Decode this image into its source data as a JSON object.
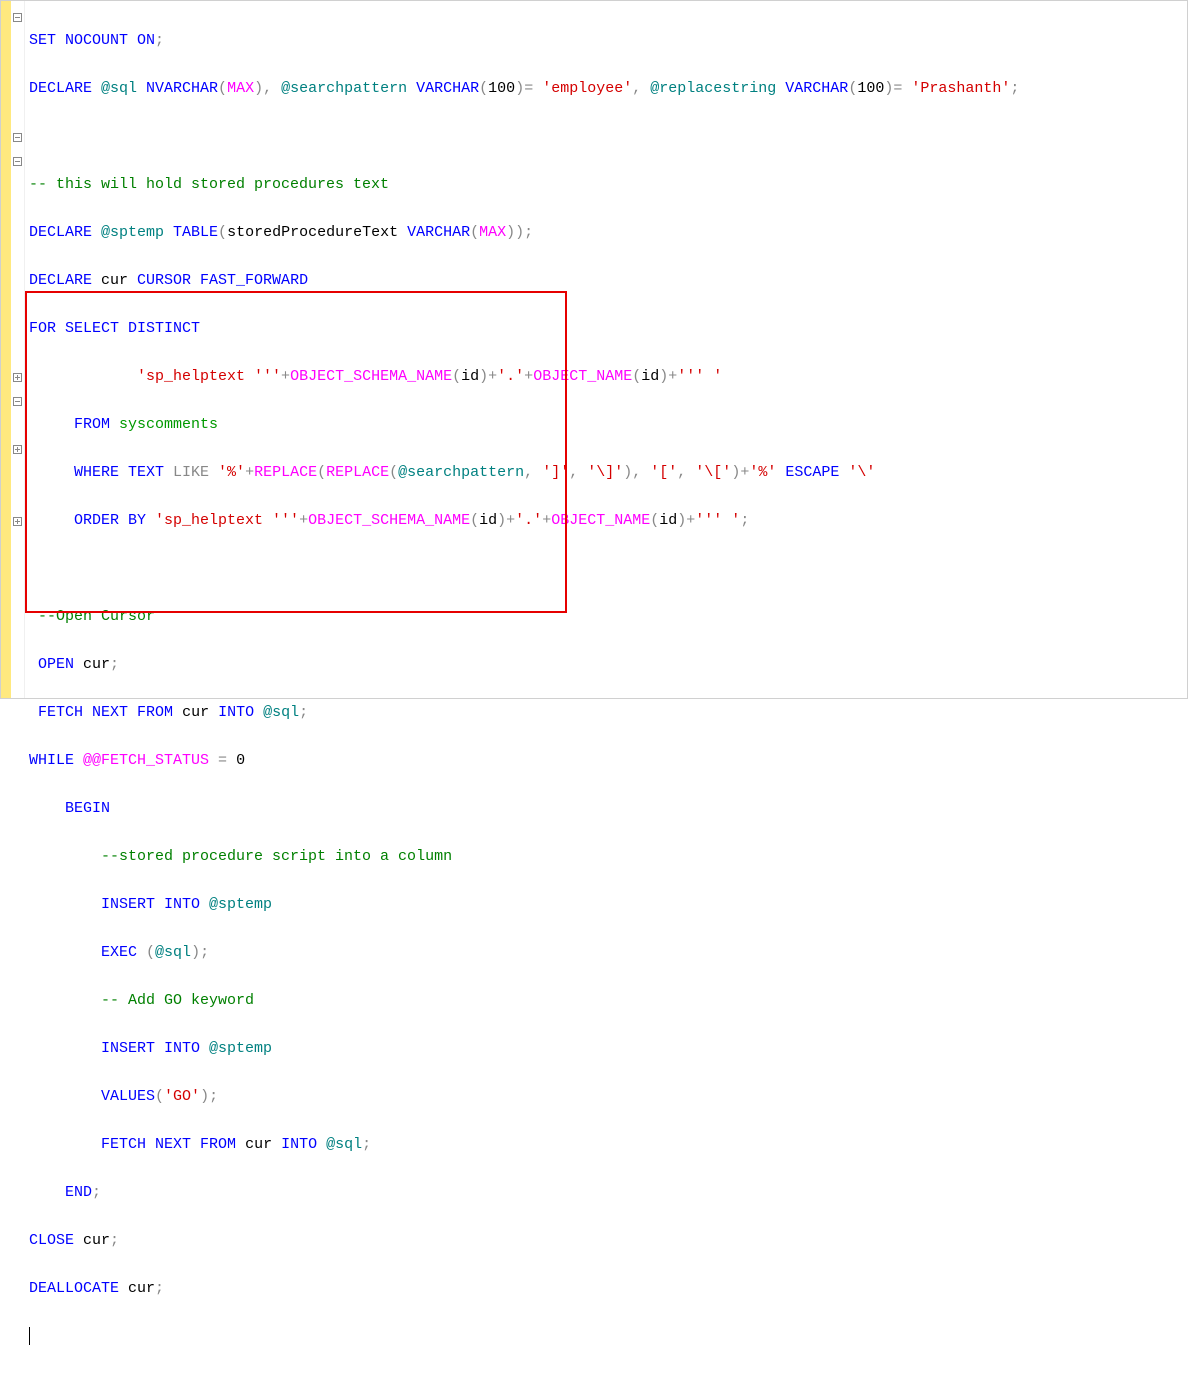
{
  "fold": {
    "l0": "minus",
    "l5": "minus",
    "l6": "minus",
    "l13": "plus",
    "l15": "minus",
    "l16": "plus",
    "l18": "plus",
    "l20": "plus"
  },
  "code": {
    "l0_set": "SET",
    "l0_nocount": " NOCOUNT",
    "l0_on": " ON",
    "l0_sc": ";",
    "l1_declare": "DECLARE",
    "l1_sql": " @sql",
    "l1_nvarchar": " NVARCHAR",
    "l1_p1": "(",
    "l1_max1": "MAX",
    "l1_p2": ")",
    "l1_c1": ",",
    "l1_sp": " @searchpattern",
    "l1_varchar": " VARCHAR",
    "l1_p3": "(",
    "l1_100a": "100",
    "l1_p4": ")",
    "l1_eq1": "=",
    "l1_emp": " 'employee'",
    "l1_c2": ",",
    "l1_rs": " @replacestring",
    "l1_varchar2": " VARCHAR",
    "l1_p5": "(",
    "l1_100b": "100",
    "l1_p6": ")",
    "l1_eq2": "=",
    "l1_pra": " 'Prashanth'",
    "l1_sc": ";",
    "l3_cmt": "-- this will hold stored procedures text",
    "l4_declare": "DECLARE",
    "l4_sptemp": " @sptemp",
    "l4_table": " TABLE",
    "l4_p1": "(",
    "l4_col": "storedProcedureText",
    "l4_varchar": " VARCHAR",
    "l4_p2": "(",
    "l4_max": "MAX",
    "l4_p3": "))",
    "l4_sc": ";",
    "l5_declare": "DECLARE",
    "l5_cur": " cur",
    "l5_cursor": " CURSOR",
    "l5_ff": " FAST_FORWARD",
    "l6_for": "FOR",
    "l6_select": " SELECT",
    "l6_distinct": " DISTINCT",
    "l7_sp": "            'sp_helptext '''",
    "l7_plus1": "+",
    "l7_osn": "OBJECT_SCHEMA_NAME",
    "l7_p1": "(",
    "l7_id1": "id",
    "l7_p2": ")",
    "l7_plus2": "+",
    "l7_dot": "'.'",
    "l7_plus3": "+",
    "l7_on": "OBJECT_NAME",
    "l7_p3": "(",
    "l7_id2": "id",
    "l7_p4": ")",
    "l7_plus4": "+",
    "l7_end": "''' '",
    "l8_from": "     FROM",
    "l8_sc": " syscomments",
    "l9_where": "     WHERE",
    "l9_text": " TEXT",
    "l9_like": " LIKE",
    "l9_pct1": " '%'",
    "l9_plus1": "+",
    "l9_rep": "REPLACE",
    "l9_p1": "(",
    "l9_rep2": "REPLACE",
    "l9_p2": "(",
    "l9_sp": "@searchpattern",
    "l9_c1": ",",
    "l9_b1": " ']'",
    "l9_c2": ",",
    "l9_b2": " '\\]'",
    "l9_p3": ")",
    "l9_c3": ",",
    "l9_b3": " '['",
    "l9_c4": ",",
    "l9_b4": " '\\['",
    "l9_p4": ")",
    "l9_plus2": "+",
    "l9_pct2": "'%'",
    "l9_escape": " ESCAPE",
    "l9_bs": " '\\'",
    "l10_order": "     ORDER",
    "l10_by": " BY",
    "l10_sp": " 'sp_helptext '''",
    "l10_plus1": "+",
    "l10_osn": "OBJECT_SCHEMA_NAME",
    "l10_p1": "(",
    "l10_id1": "id",
    "l10_p2": ")",
    "l10_plus2": "+",
    "l10_dot": "'.'",
    "l10_plus3": "+",
    "l10_on": "OBJECT_NAME",
    "l10_p3": "(",
    "l10_id2": "id",
    "l10_p4": ")",
    "l10_plus4": "+",
    "l10_end": "''' '",
    "l10_sc": ";",
    "l12_cmt": "--Open Cursor",
    "l13_open": "OPEN",
    "l13_cur": " cur",
    "l13_sc": ";",
    "l14_fetch": "FETCH",
    "l14_next": " NEXT",
    "l14_from": " FROM",
    "l14_cur": " cur",
    "l14_into": " INTO",
    "l14_sql": " @sql",
    "l14_sc": ";",
    "l15_while": "WHILE",
    "l15_fs": " @@FETCH_STATUS",
    "l15_eq": " =",
    "l15_zero": " 0",
    "l16_begin": "    BEGIN",
    "l17_cmt": "        --stored procedure script into a column",
    "l18_insert": "        INSERT",
    "l18_into": " INTO",
    "l18_sptemp": " @sptemp",
    "l19_exec": "        EXEC",
    "l19_p1": " (",
    "l19_sql": "@sql",
    "l19_p2": ")",
    "l19_sc": ";",
    "l20_cmt": "        -- Add GO keyword",
    "l21_insert": "        INSERT",
    "l21_into": " INTO",
    "l21_sptemp": " @sptemp",
    "l22_values": "        VALUES",
    "l22_p1": "(",
    "l22_go": "'GO'",
    "l22_p2": ")",
    "l22_sc": ";",
    "l23_fetch": "        FETCH",
    "l23_next": " NEXT",
    "l23_from": " FROM",
    "l23_cur": " cur",
    "l23_into": " INTO",
    "l23_sql": " @sql",
    "l23_sc": ";",
    "l24_end": "    END",
    "l24_sc": ";",
    "l25_close": "CLOSE",
    "l25_cur": " cur",
    "l25_sc": ";",
    "l26_dealloc": "DEALLOCATE",
    "l26_cur": " cur",
    "l26_sc": ";"
  }
}
